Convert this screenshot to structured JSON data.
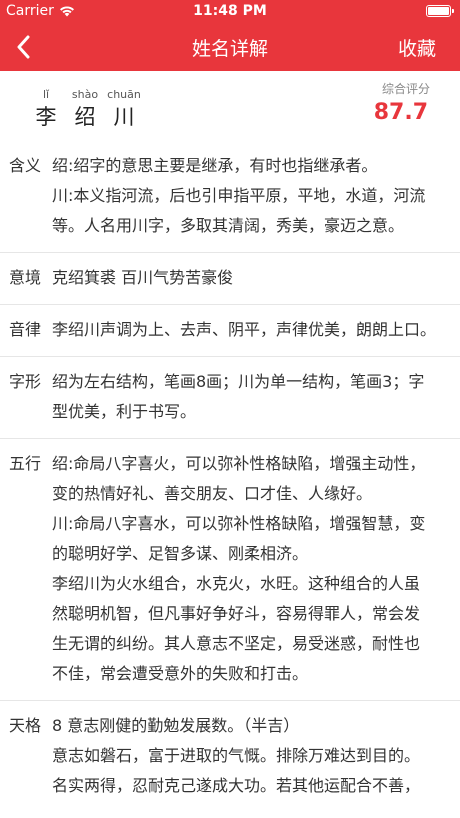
{
  "status": {
    "carrier": "Carrier",
    "time": "11:48 PM"
  },
  "nav": {
    "title": "姓名详解",
    "favorite": "收藏"
  },
  "name": {
    "chars": [
      {
        "pinyin": "lǐ",
        "hanzi": "李"
      },
      {
        "pinyin": "shào",
        "hanzi": "绍"
      },
      {
        "pinyin": "chuān",
        "hanzi": "川"
      }
    ],
    "score_label": "综合评分",
    "score": "87.7"
  },
  "sections": [
    {
      "label": "含义",
      "lines": [
        "绍:绍字的意思主要是继承，有时也指继承者。",
        "川:本义指河流，后也引申指平原，平地，水道，河流",
        "等。人名用川字，多取其清阔，秀美，豪迈之意。"
      ]
    },
    {
      "label": "意境",
      "lines": [
        " 克绍箕裘 百川气势苦豪俊"
      ]
    },
    {
      "label": "音律",
      "lines": [
        "李绍川声调为上、去声、阴平，声律优美，朗朗上口。"
      ]
    },
    {
      "label": "字形",
      "lines": [
        "绍为左右结构，笔画8画；川为单一结构，笔画3；字",
        "型优美，利于书写。"
      ]
    },
    {
      "label": "五行",
      "lines": [
        "绍:命局八字喜火，可以弥补性格缺陷，增强主动性，",
        "变的热情好礼、善交朋友、口才佳、人缘好。",
        "川:命局八字喜水，可以弥补性格缺陷，增强智慧，变",
        "的聪明好学、足智多谋、刚柔相济。",
        "李绍川为火水组合，水克火，水旺。这种组合的人虽",
        "然聪明机智，但凡事好争好斗，容易得罪人，常会发",
        "生无谓的纠纷。其人意志不坚定，易受迷惑，耐性也",
        "不佳，常会遭受意外的失败和打击。"
      ]
    },
    {
      "label": "天格",
      "lines": [
        "8 意志刚健的勤勉发展数。（半吉）",
        "意志如磐石，富于进取的气慨。排除万难达到目的。",
        "名实两得，忍耐克己遂成大功。若其他运配合不善，"
      ]
    }
  ]
}
